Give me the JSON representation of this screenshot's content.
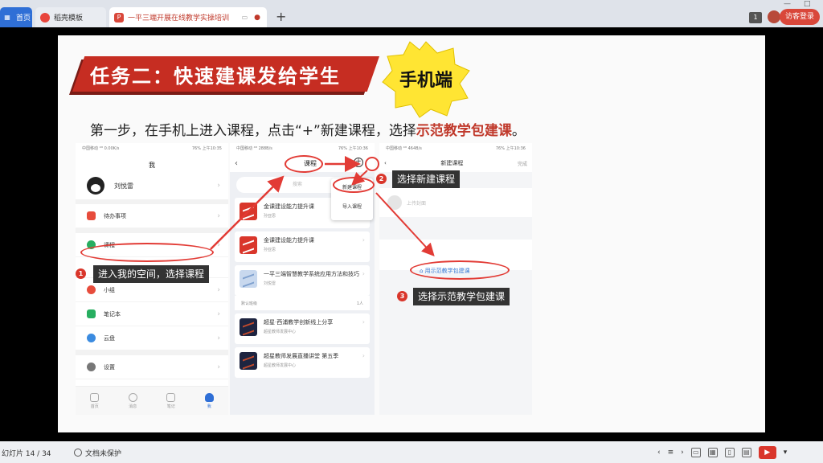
{
  "tabs": {
    "home": "首页",
    "template": "稻壳模板",
    "active": "一平三端开展在线教学实操培训",
    "add": "+"
  },
  "topbar": {
    "badge": "1",
    "login": "访客登录"
  },
  "slide": {
    "banner": "任务二：快速建课发给学生",
    "badge": "手机端",
    "step_prefix": "第一步，在手机上进入课程，点击“+”新建课程，选择",
    "step_highlight": "示范教学包建课",
    "step_suffix": "。"
  },
  "phone1": {
    "status_left": "中国移动 ⁴ᴳ 0.00K/s",
    "status_right": "76% 上午10:35",
    "title": "我",
    "profile_name": "刘悦雷",
    "menu": [
      "待办事项",
      "课程",
      "小组",
      "笔记本",
      "云盘",
      "设置"
    ],
    "nav": [
      "首页",
      "消息",
      "笔记",
      "我"
    ]
  },
  "phone2": {
    "status_left": "中国移动 ⁴ᴳ 288B/s",
    "status_right": "76% 上午10:36",
    "title": "课程",
    "search_placeholder": "搜索",
    "courses": [
      {
        "title": "金课建设能力提升课",
        "sub": "孙亚思"
      },
      {
        "title": "金课建设能力提升课",
        "sub": "孙亚思"
      },
      {
        "title": "一平三端智慧教学系统应用方法和技巧",
        "sub": "刘悦雷"
      },
      {
        "title": "超星·西浦教学创新线上分享",
        "sub": "超星教师发展中心"
      },
      {
        "title": "超星教师发展直播讲堂 第五季",
        "sub": "超星教师发展中心"
      }
    ],
    "default_group": "默认班级",
    "default_count": "1人",
    "popup": [
      "新建课程",
      "导入课程"
    ]
  },
  "phone3": {
    "status_left": "中国移动 ⁴ᴳ 464B/s",
    "status_right": "76% 上午10:36",
    "title": "新建课程",
    "done": "完成",
    "cover": "上传封面",
    "demo_link": "用示范教学包建课"
  },
  "callouts": {
    "c1_num": "1",
    "c1": "进入我的空间，选择课程",
    "c2_num": "2",
    "c2": "选择新建课程",
    "c3_num": "3",
    "c3": "选择示范教学包建课"
  },
  "statusbar": {
    "slide_counter": "幻灯片 14 / 34",
    "protect": "文档未保护"
  },
  "colors": {
    "banner_red": "#c62d22",
    "badge_yellow": "#ffe533",
    "accent_blue": "#2f6fd6",
    "annotation_red": "#e23b35"
  }
}
